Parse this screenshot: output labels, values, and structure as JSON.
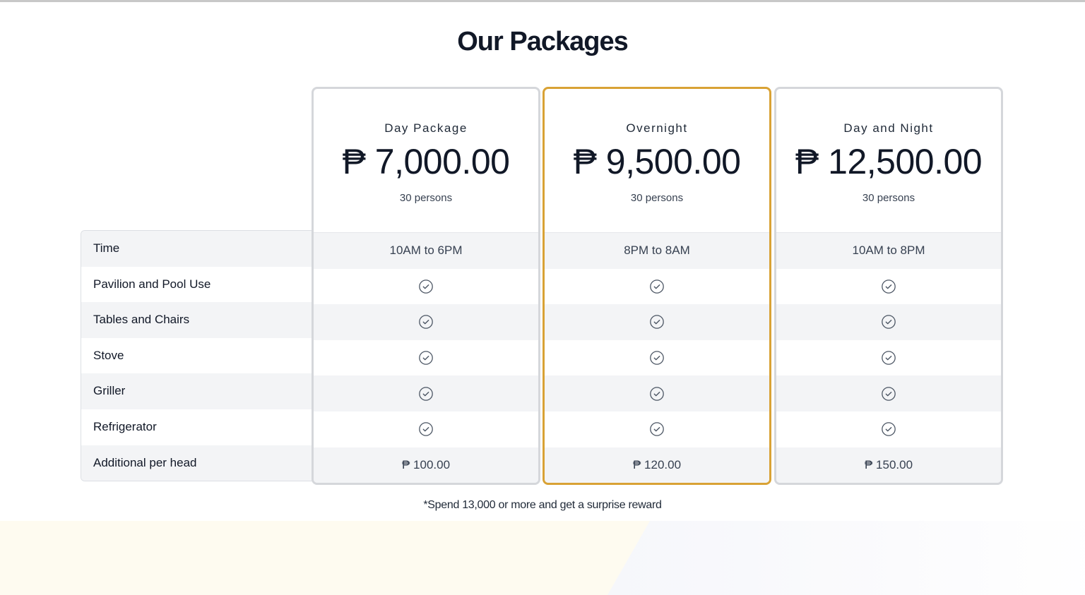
{
  "heading": "Our Packages",
  "accent_color": "#d9a235",
  "feature_labels": [
    "Time",
    "Pavilion and Pool Use",
    "Tables and Chairs",
    "Stove",
    "Griller",
    "Refrigerator",
    "Additional per head"
  ],
  "packages": [
    {
      "name": "Day Package",
      "price": "₱ 7,000.00",
      "capacity": "30 persons",
      "time": "10AM to 6PM",
      "extra": "₱ 100.00",
      "featured": false
    },
    {
      "name": "Overnight",
      "price": "₱ 9,500.00",
      "capacity": "30 persons",
      "time": "8PM to 8AM",
      "extra": "₱ 120.00",
      "featured": true
    },
    {
      "name": "Day and Night",
      "price": "₱ 12,500.00",
      "capacity": "30 persons",
      "time": "10AM to 8PM",
      "extra": "₱ 150.00",
      "featured": false
    }
  ],
  "included_icon": "check-circle-icon",
  "footnote": "*Spend 13,000 or more and get a surprise reward"
}
